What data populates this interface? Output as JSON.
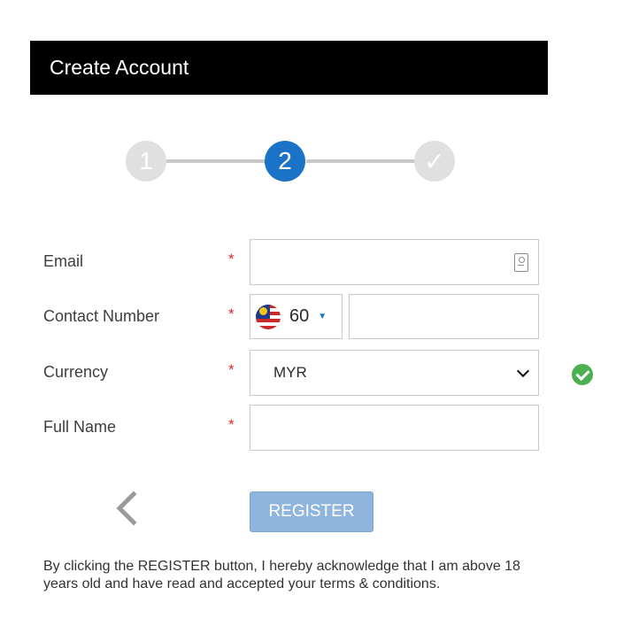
{
  "header": {
    "title": "Create Account"
  },
  "stepper": {
    "steps": [
      {
        "label": "1",
        "state": "inactive"
      },
      {
        "label": "2",
        "state": "active"
      },
      {
        "label": "✓",
        "state": "inactive"
      }
    ],
    "active_color": "#1a73c6",
    "inactive_color": "#e0e0e0"
  },
  "form": {
    "required_marker": "*",
    "email": {
      "label": "Email",
      "value": "",
      "icon": "contact-card-icon"
    },
    "contact": {
      "label": "Contact Number",
      "country_code": "60",
      "flag": "malaysia-flag-icon",
      "value": ""
    },
    "currency": {
      "label": "Currency",
      "value": "MYR",
      "status_icon": "check-circle-icon",
      "status_color": "#4caf50"
    },
    "full_name": {
      "label": "Full Name",
      "value": ""
    }
  },
  "actions": {
    "back_icon": "chevron-left-icon",
    "register_label": "REGISTER",
    "register_color": "#8fb5de"
  },
  "disclaimer": "By clicking the REGISTER button, I hereby acknowledge that I am above 18 years old and have read and accepted your terms & conditions."
}
